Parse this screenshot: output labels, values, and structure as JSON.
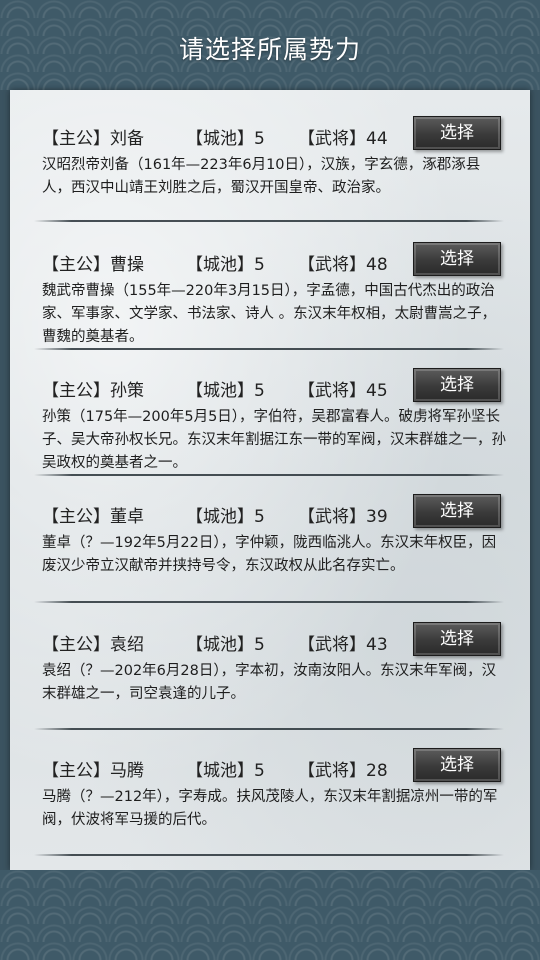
{
  "header": {
    "title": "请选择所属势力"
  },
  "labels": {
    "lord": "【主公】",
    "cities": "【城池】",
    "generals": "【武将】",
    "select": "选择"
  },
  "factions": [
    {
      "lord_name": "刘备",
      "cities": "5",
      "generals": "44",
      "description": "汉昭烈帝刘备（161年—223年6月10日），汉族，字玄德，涿郡涿县人，西汉中山靖王刘胜之后，蜀汉开国皇帝、政治家。"
    },
    {
      "lord_name": "曹操",
      "cities": "5",
      "generals": "48",
      "description": "魏武帝曹操（155年—220年3月15日），字孟德，中国古代杰出的政治家、军事家、文学家、书法家、诗人 。东汉末年权相，太尉曹嵩之子，曹魏的奠基者。"
    },
    {
      "lord_name": "孙策",
      "cities": "5",
      "generals": "45",
      "description": "孙策（175年—200年5月5日），字伯符，吴郡富春人。破虏将军孙坚长子、吴大帝孙权长兄。东汉末年割据江东一带的军阀，汉末群雄之一，孙吴政权的奠基者之一。"
    },
    {
      "lord_name": "董卓",
      "cities": "5",
      "generals": "39",
      "description": "董卓（？—192年5月22日），字仲颖，陇西临洮人。东汉末年权臣，因废汉少帝立汉献帝并挟持号令，东汉政权从此名存实亡。"
    },
    {
      "lord_name": "袁绍",
      "cities": "5",
      "generals": "43",
      "description": "袁绍（？—202年6月28日），字本初，汝南汝阳人。东汉末年军阀，汉末群雄之一，司空袁逢的儿子。"
    },
    {
      "lord_name": "马腾",
      "cities": "5",
      "generals": "28",
      "description": "马腾（？—212年），字寿成。扶风茂陵人，东汉末年割据凉州一带的军阀，伏波将军马援的后代。"
    }
  ]
}
